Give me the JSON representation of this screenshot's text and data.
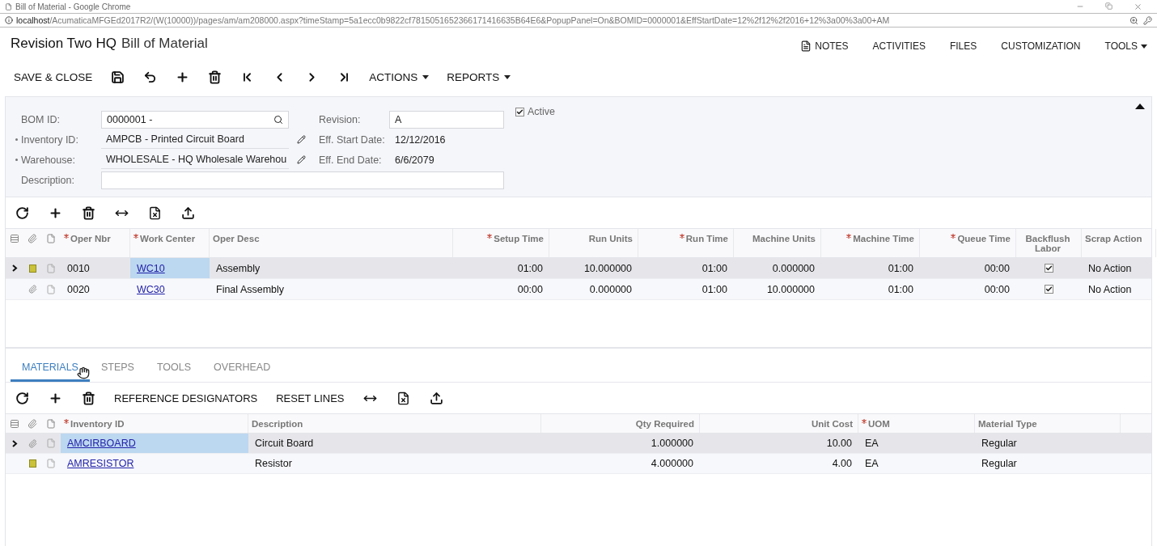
{
  "browser": {
    "title": "Bill of Material - Google Chrome",
    "host": "localhost",
    "path": "/AcumaticaMFGEd2017R2/(W(10000))/pages/am/am208000.aspx?timeStamp=5a1ecc0b9822cf7815051652366171416635B64E6&PopupPanel=On&BOMID=0000001&EffStartDate=12%2f12%2f2016+12%3a00%3a00+AM"
  },
  "header": {
    "record": "Revision Two HQ",
    "screen": "Bill of Material",
    "links": [
      {
        "label": "NOTES",
        "kind": "notes"
      },
      {
        "label": "ACTIVITIES",
        "kind": "plain"
      },
      {
        "label": "FILES",
        "kind": "plain"
      },
      {
        "label": "CUSTOMIZATION",
        "kind": "plain"
      },
      {
        "label": "TOOLS",
        "kind": "menu"
      }
    ]
  },
  "toolbar": [
    {
      "kind": "text",
      "label": "SAVE & CLOSE"
    },
    {
      "kind": "save"
    },
    {
      "kind": "undo"
    },
    {
      "kind": "add"
    },
    {
      "kind": "delete"
    },
    {
      "kind": "first"
    },
    {
      "kind": "prev"
    },
    {
      "kind": "next"
    },
    {
      "kind": "last"
    },
    {
      "kind": "menu",
      "label": "ACTIONS"
    },
    {
      "kind": "menu",
      "label": "REPORTS"
    }
  ],
  "form": {
    "left": [
      {
        "label": "BOM ID:",
        "value": "0000001 -",
        "required": false,
        "kind": "search"
      },
      {
        "label": "Inventory ID:",
        "value": "AMPCB - Printed Circuit Board",
        "required": true,
        "kind": "edit"
      },
      {
        "label": "Warehouse:",
        "value": "WHOLESALE - HQ Wholesale Warehou",
        "required": true,
        "kind": "edit"
      }
    ],
    "right": [
      {
        "label": "Revision:",
        "value": "A",
        "kind": "box"
      },
      {
        "label": "Eff. Start Date:",
        "value": "12/12/2016",
        "kind": "plain"
      },
      {
        "label": "Eff. End Date:",
        "value": "6/6/2079",
        "kind": "plain"
      }
    ],
    "active": {
      "label": "Active",
      "checked": true
    },
    "description": {
      "label": "Description:"
    }
  },
  "operations": {
    "toolbar": [
      {
        "kind": "refresh"
      },
      {
        "kind": "add"
      },
      {
        "kind": "delete"
      },
      {
        "kind": "fit"
      },
      {
        "kind": "export"
      },
      {
        "kind": "upload"
      }
    ],
    "columns": [
      {
        "label": "Oper Nbr",
        "required": true,
        "kind": "text"
      },
      {
        "label": "Work Center",
        "required": true,
        "kind": "link"
      },
      {
        "label": "Oper Desc",
        "required": false,
        "kind": "text"
      },
      {
        "label": "Setup Time",
        "required": true,
        "kind": "number"
      },
      {
        "label": "Run Units",
        "required": false,
        "kind": "number"
      },
      {
        "label": "Run Time",
        "required": true,
        "kind": "number"
      },
      {
        "label": "Machine Units",
        "required": false,
        "kind": "number"
      },
      {
        "label": "Machine Time",
        "required": true,
        "kind": "number"
      },
      {
        "label": "Queue Time",
        "required": true,
        "kind": "number"
      },
      {
        "label": "Backflush Labor",
        "required": false,
        "kind": "check"
      },
      {
        "label": "Scrap Action",
        "required": false,
        "kind": "text"
      }
    ],
    "rows": [
      {
        "selected": true,
        "has_note": true,
        "cells": [
          "0010",
          "WC10",
          "Assembly",
          "01:00",
          "10.000000",
          "01:00",
          "0.000000",
          "01:00",
          "00:00",
          true,
          "No Action"
        ]
      },
      {
        "selected": false,
        "has_note": false,
        "cells": [
          "0020",
          "WC30",
          "Final Assembly",
          "00:00",
          "0.000000",
          "01:00",
          "10.000000",
          "01:00",
          "00:00",
          true,
          "No Action"
        ]
      }
    ]
  },
  "tabs": [
    {
      "label": "MATERIALS",
      "selected": true
    },
    {
      "label": "STEPS",
      "selected": false
    },
    {
      "label": "TOOLS",
      "selected": false
    },
    {
      "label": "OVERHEAD",
      "selected": false
    }
  ],
  "materials": {
    "toolbar": [
      {
        "kind": "refresh"
      },
      {
        "kind": "add"
      },
      {
        "kind": "delete"
      },
      {
        "kind": "text",
        "label": "REFERENCE DESIGNATORS"
      },
      {
        "kind": "text",
        "label": "RESET LINES"
      },
      {
        "kind": "fit"
      },
      {
        "kind": "export"
      },
      {
        "kind": "upload"
      }
    ],
    "columns": [
      {
        "label": "Inventory ID",
        "required": true,
        "kind": "link"
      },
      {
        "label": "Description",
        "required": false,
        "kind": "text"
      },
      {
        "label": "Qty Required",
        "required": false,
        "kind": "number"
      },
      {
        "label": "Unit Cost",
        "required": false,
        "kind": "number"
      },
      {
        "label": "UOM",
        "required": true,
        "kind": "text"
      },
      {
        "label": "Material Type",
        "required": false,
        "kind": "text"
      }
    ],
    "rows": [
      {
        "selected": true,
        "has_note": false,
        "cells": [
          "AMCIRBOARD",
          "Circuit Board",
          "1.000000",
          "10.00",
          "EA",
          "Regular"
        ]
      },
      {
        "selected": false,
        "has_note": true,
        "cells": [
          "AMRESISTOR",
          "Resistor",
          "4.000000",
          "4.00",
          "EA",
          "Regular"
        ]
      }
    ]
  }
}
